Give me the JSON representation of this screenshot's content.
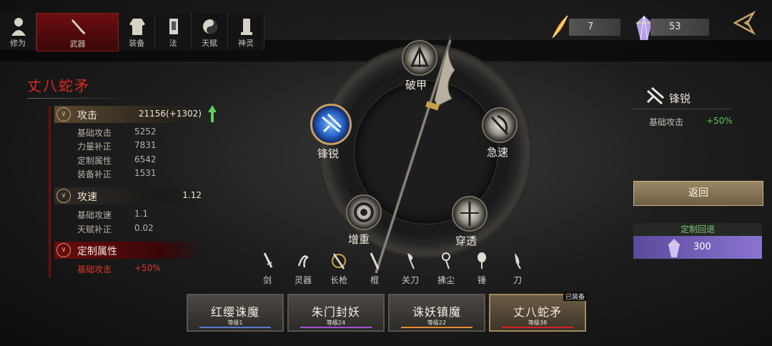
{
  "tabs": [
    {
      "label": "修为",
      "icon": "figure-icon",
      "active": false
    },
    {
      "label": "武器",
      "icon": "sword-icon",
      "active": true
    },
    {
      "label": "装备",
      "icon": "robe-icon",
      "active": false
    },
    {
      "label": "法",
      "icon": "charm-icon",
      "active": false
    },
    {
      "label": "天赋",
      "icon": "yinyang-icon",
      "active": false
    },
    {
      "label": "神灵",
      "icon": "shrine-icon",
      "active": false
    }
  ],
  "currency": {
    "feather": {
      "icon": "feather-icon",
      "value": "7"
    },
    "crystal": {
      "icon": "crystal-icon",
      "value": "53"
    }
  },
  "weapon": {
    "name": "丈八蛇矛",
    "attack": {
      "label": "攻击",
      "value": "21156",
      "bonus": "(+1302)",
      "rows": [
        {
          "label": "基础攻击",
          "value": "5252"
        },
        {
          "label": "力量补正",
          "value": "7831"
        },
        {
          "label": "定制属性",
          "value": "6542"
        },
        {
          "label": "装备补正",
          "value": "1531"
        }
      ]
    },
    "speed": {
      "label": "攻速",
      "value": "1.12",
      "rows": [
        {
          "label": "基础攻速",
          "value": "1.1"
        },
        {
          "label": "天赋补正",
          "value": "0.02"
        }
      ]
    },
    "custom": {
      "label": "定制属性",
      "rows": [
        {
          "label": "基础攻击",
          "value": "+50%"
        }
      ]
    }
  },
  "wheel": {
    "nodes": [
      {
        "label": "破甲",
        "icon": "armor-break-icon"
      },
      {
        "label": "急速",
        "icon": "haste-icon"
      },
      {
        "label": "穿透",
        "icon": "pierce-icon"
      },
      {
        "label": "增重",
        "icon": "weight-icon"
      },
      {
        "label": "锋锐",
        "icon": "sharp-icon",
        "selected": true
      }
    ]
  },
  "detail": {
    "title": "锋锐",
    "icon": "sharp-icon",
    "stat_label": "基础攻击",
    "stat_value": "+50%",
    "return_label": "返回",
    "revert_label": "定制回退",
    "cost": "300"
  },
  "weapon_types": [
    {
      "label": "剑",
      "icon": "sword-type-icon"
    },
    {
      "label": "灵器",
      "icon": "spirit-item-icon"
    },
    {
      "label": "长枪",
      "icon": "spear-type-icon",
      "selected": true
    },
    {
      "label": "棍",
      "icon": "staff-type-icon"
    },
    {
      "label": "关刀",
      "icon": "guandao-icon"
    },
    {
      "label": "拂尘",
      "icon": "whisk-icon"
    },
    {
      "label": "锤",
      "icon": "hammer-icon"
    },
    {
      "label": "刀",
      "icon": "blade-icon"
    }
  ],
  "cards": [
    {
      "name": "红缨诛魔",
      "level": "等级1",
      "color": "#5a7ad0"
    },
    {
      "name": "朱门封妖",
      "level": "等级24",
      "color": "#a050d8"
    },
    {
      "name": "诛妖镇魔",
      "level": "等级22",
      "color": "#e08a2a"
    },
    {
      "name": "丈八蛇矛",
      "level": "等级38",
      "color": "#d82020",
      "selected": true
    }
  ],
  "equipped_label": "已装备"
}
